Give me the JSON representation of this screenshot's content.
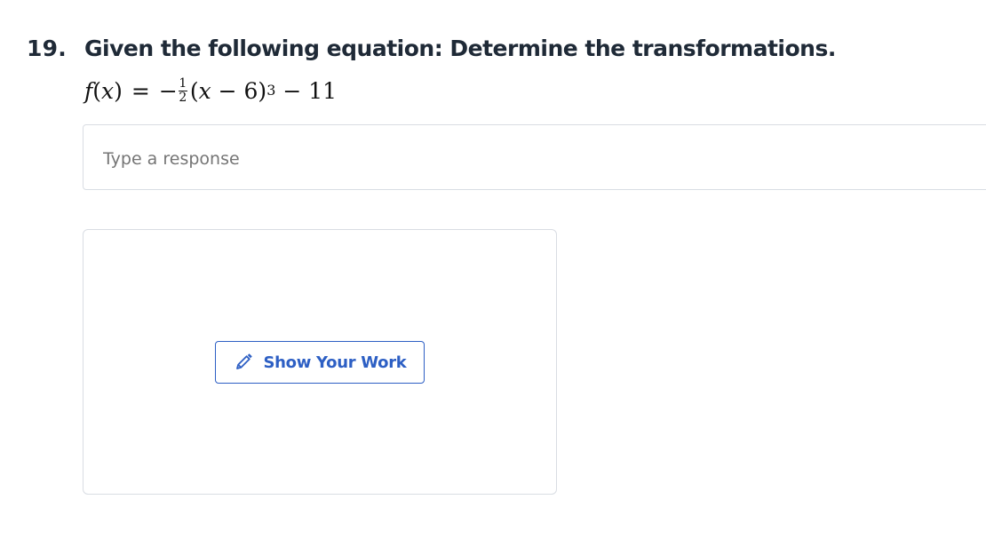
{
  "question": {
    "number": "19.",
    "text": "Given the following equation: Determine the transformations.",
    "equation": {
      "lhs_func": "f",
      "lhs_var": "x",
      "equals": "=",
      "sign": "−",
      "frac_num": "1",
      "frac_den": "2",
      "base_var": "x",
      "base_rest": " − 6)",
      "exponent": "3",
      "tail": " − 11"
    }
  },
  "response": {
    "placeholder": "Type a response",
    "value": ""
  },
  "show_work": {
    "label": "Show Your Work",
    "icon": "pencil-icon"
  },
  "colors": {
    "accent": "#2d5fc4",
    "text": "#1f2a37",
    "border": "#d9dde3"
  }
}
